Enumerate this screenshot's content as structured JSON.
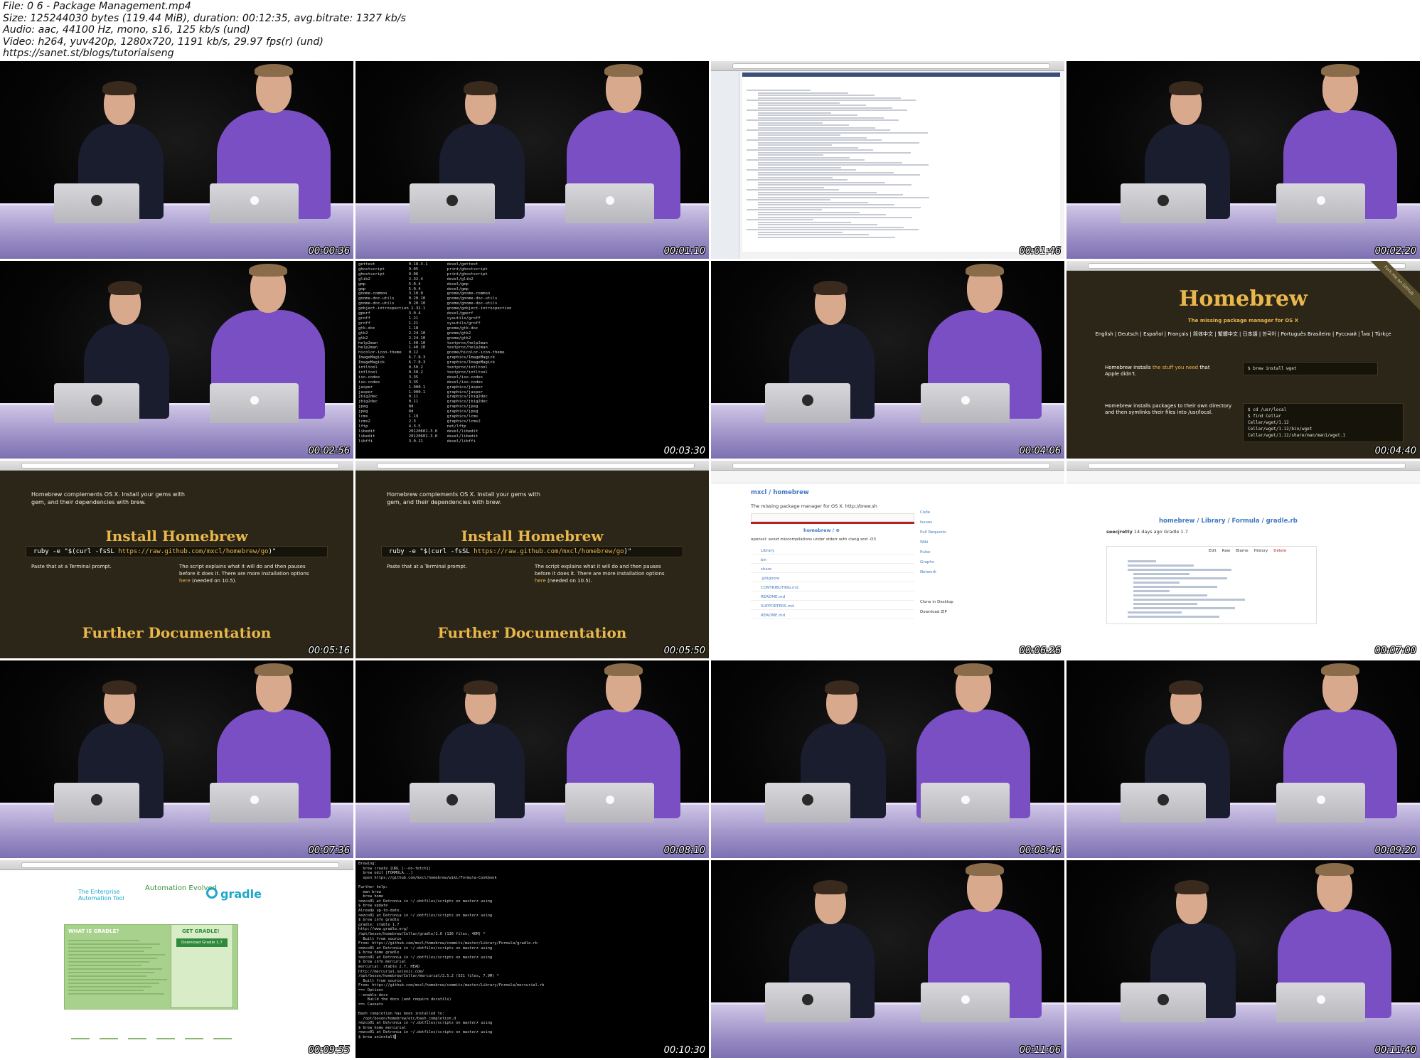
{
  "header": {
    "file": "File: 0 6 - Package Management.mp4",
    "size": "Size: 125244030 bytes (119.44 MiB), duration: 00:12:35, avg.bitrate: 1327 kb/s",
    "audio": "Audio: aac, 44100 Hz, mono, s16, 125 kb/s (und)",
    "video": "Video: h264, yuv420p, 1280x720, 1191 kb/s, 29.97 fps(r) (und)",
    "url": "https://sanet.st/blogs/tutorialseng"
  },
  "thumbnails": [
    {
      "time": "00:00:36",
      "kind": "studio"
    },
    {
      "time": "00:01:10",
      "kind": "studio"
    },
    {
      "time": "00:01:46",
      "kind": "web"
    },
    {
      "time": "00:02:20",
      "kind": "studio"
    },
    {
      "time": "00:02:56",
      "kind": "studio"
    },
    {
      "time": "00:03:30",
      "kind": "terminal-list"
    },
    {
      "time": "00:04:06",
      "kind": "studio"
    },
    {
      "time": "00:04:40",
      "kind": "homebrew"
    },
    {
      "time": "00:05:16",
      "kind": "install"
    },
    {
      "time": "00:05:50",
      "kind": "install"
    },
    {
      "time": "00:06:26",
      "kind": "github-repo"
    },
    {
      "time": "00:07:00",
      "kind": "github-file"
    },
    {
      "time": "00:07:36",
      "kind": "studio"
    },
    {
      "time": "00:08:10",
      "kind": "studio"
    },
    {
      "time": "00:08:46",
      "kind": "studio"
    },
    {
      "time": "00:09:20",
      "kind": "studio"
    },
    {
      "time": "00:09:55",
      "kind": "gradle"
    },
    {
      "time": "00:10:30",
      "kind": "terminal"
    },
    {
      "time": "00:11:06",
      "kind": "studio"
    },
    {
      "time": "00:11:40",
      "kind": "studio"
    }
  ],
  "homebrew": {
    "title": "Homebrew",
    "subtitle": "The missing package manager for OS X",
    "languages": "English | Deutsch | Español | Français | 简体中文 | 繁體中文 | 日本語 | 한국어 | Português Brasileiro | Русский | ไทย | Türkçe",
    "install_text_a": "Homebrew installs",
    "install_text_b": "the stuff you need",
    "install_text_c": "that Apple didn't.",
    "install_cmd": "$ brew install wget",
    "symlink_text": "Homebrew installs packages to their own directory and then symlinks their files into /usr/local.",
    "symlink_cmd": "$ cd /usr/local\n$ find Cellar\nCellar/wget/1.12\nCellar/wget/1.12/bin/wget\nCellar/wget/1.12/share/man/man1/wget.1",
    "ribbon": "Fork me on GitHub"
  },
  "install": {
    "top_text_a": "Homebrew complements OS X. Install your gems with",
    "top_text_b": "gem, and their dependencies with brew.",
    "heading": "Install Homebrew",
    "cmd_prefix": "ruby -e \"$(curl -fsSL ",
    "cmd_url": "https://raw.github.com/mxcl/homebrew/go",
    "cmd_suffix": ")\"",
    "paste": "Paste that at a Terminal prompt.",
    "explain_a": "The script explains what it will do and then pauses",
    "explain_b": "before it does it. There are more installation options",
    "explain_link": "here",
    "explain_c": " (needed on 10.5).",
    "heading2": "Further Documentation"
  },
  "github_repo": {
    "owner_repo": "mxcl / homebrew",
    "desc": "The missing package manager for OS X. http://brew.sh",
    "branch": "homebrew / ⊕",
    "commit": "openssl: avoid miscompilations under stderr with clang and -O3",
    "files": [
      "Library",
      "bin",
      "share",
      ".gitignore",
      "CONTRIBUTING.md",
      "README.md",
      "SUPPORTERS.md",
      "README.md"
    ],
    "side": [
      "Code",
      "Issues",
      "Pull Requests",
      "Wiki",
      "Pulse",
      "Graphs",
      "Network"
    ],
    "clone": "Clone in Desktop",
    "download": "Download ZIP"
  },
  "github_file": {
    "path": "homebrew / Library / Formula / gradle.rb",
    "committer": "seecjretty",
    "commit_msg": "14 days ago Gradle 1.7",
    "actions": [
      "Edit",
      "Raw",
      "Blame",
      "History",
      "Delete"
    ]
  },
  "gradle": {
    "tagline": "The Enterprise Automation Tool",
    "headline": "Automation Evolved",
    "logo": "gradle",
    "what": "WHAT IS GRADLE?",
    "get": "GET GRADLE!",
    "download": "Download Gradle 1.7"
  },
  "terminal_list": "gettext              0.18.3.1        devel/gettext\nghostscript          9.05            print/ghostscript\nghostscript          9.06            print/ghostscript\nglib2                2.32.4          devel/glib2\ngmp                  5.0.4           devel/gmp\ngmp                  5.0.4           devel/gmp\ngnome-common         3.10.0          gnome/gnome-common\ngnome-doc-utils      0.20.10         gnome/gnome-doc-utils\ngnome-doc-utils      0.20.10         gnome/gnome-doc-utils\ngobject-introspection 1.32.1         gnome/gobject-introspection\ngperf                3.0.4           devel/gperf\ngroff                1.21            sysutils/groff\ngroff                1.21            sysutils/groff\ngtk-doc              1.18            gnome/gtk-doc\ngtk2                 2.24.10         gnome/gtk2\ngtk2                 2.24.10         gnome/gtk2\nhelp2man             1.40.10         textproc/help2man\nhelp2man             1.40.10         textproc/help2man\nhicolor-icon-theme   0.12            gnome/hicolor-icon-theme\nImageMagick          6.7.8-3         graphics/ImageMagick\nImageMagick          6.7.8-3         graphics/ImageMagick\nintltool             0.50.2          textproc/intltool\nintltool             0.50.2          textproc/intltool\niso-codes            3.35            devel/iso-codes\niso-codes            3.35            devel/iso-codes\njasper               1.900.1         graphics/jasper\njasper               1.900.1         graphics/jasper\njbig2dec             0.11            graphics/jbig2dec\njbig2dec             0.11            graphics/jbig2dec\njpeg                 8d              graphics/jpeg\njpeg                 8d              graphics/jpeg\nlcms                 1.19            graphics/lcms\nlcms2                2.3             graphics/lcms2\nlftp                 4.3.5           net/lftp\nlibedit              20120601-3.0    devel/libedit\nlibedit              20120601-3.0    devel/libedit\nlibffi               3.0.11          devel/libffi",
  "terminal": "Brewing:\n  brew create [URL [--no-fetch]]\n  brew edit [FORMULA...]\n  open https://github.com/mxcl/homebrew/wiki/Formula-Cookbook\n\nFurther help:\n  man brew\n  brew home\n>mzco01 at Detronia in ~/.dotfiles/scripts on master✗ using\n$ brew update\nAlready up-to-date.\n>mzco01 at Detronia in ~/.dotfiles/scripts on master✗ using\n$ brew info gradle\ngradle: stable 1.7\nhttp://www.gradle.org/\n/opt/boxen/homebrew/Cellar/gradle/1.6 (136 files, 46M) *\n  Built from source\nFrom: https://github.com/mxcl/homebrew/commits/master/Library/Formula/gradle.rb\n>mzco01 at Detronia in ~/.dotfiles/scripts on master✗ using\n$ brew home gradle\n>mzco01 at Detronia in ~/.dotfiles/scripts on master✗ using\n$ brew info mercurial\nmercurial: stable 2.7, HEAD\nhttp://mercurial.selenic.com/\n/opt/boxen/homebrew/Cellar/mercurial/2.5.2 (531 files, 7.9M) *\n  Built from source\nFrom: https://github.com/mxcl/homebrew/commits/master/Library/Formula/mercurial.rb\n==> Options\n--enable-docs\n    Build the docs (and require docutils)\n==> Caveats\n\nBash completion has been installed to:\n  /opt/boxen/homebrew/etc/bash_completion.d\n>mzco01 at Detronia in ~/.dotfiles/scripts on master✗ using\n$ brew home mercurial\n>mzco01 at Detronia in ~/.dotfiles/scripts on master✗ using\n$ brew uninstall▌"
}
